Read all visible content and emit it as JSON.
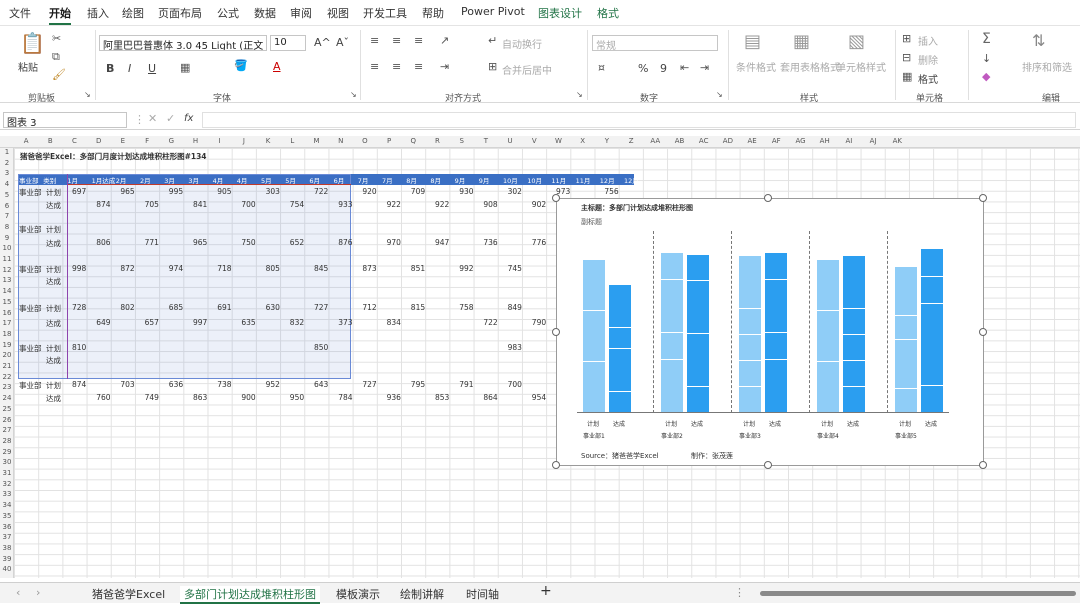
{
  "menu": {
    "file": "文件",
    "home": "开始",
    "insert": "插入",
    "draw": "绘图",
    "page_layout": "页面布局",
    "formulas": "公式",
    "data": "数据",
    "review": "审阅",
    "view": "视图",
    "developer": "开发工具",
    "help": "帮助",
    "power_pivot": "Power Pivot",
    "chart_design": "图表设计",
    "format": "格式"
  },
  "ribbon": {
    "clipboard": {
      "paste": "粘贴",
      "group": "剪贴板"
    },
    "font": {
      "family": "阿里巴巴普惠体 3.0 45 Light (正文",
      "size": "10",
      "bold": "B",
      "italic": "I",
      "underline": "U",
      "font_color_glyph": "A",
      "grow": "A^",
      "shrink": "Aˇ",
      "group": "字体"
    },
    "alignment": {
      "wrap": "自动换行",
      "merge": "合并后居中",
      "group": "对齐方式"
    },
    "number": {
      "format": "常规",
      "percent": "%",
      "comma": "9",
      "group": "数字"
    },
    "styles": {
      "conditional": "条件格式",
      "as_table": "套用表格格式",
      "cell_styles": "单元格样式",
      "group": "样式"
    },
    "cells": {
      "insert": "插入",
      "delete": "删除",
      "format": "格式",
      "group": "单元格"
    },
    "editing": {
      "sum": "Σ",
      "sort": "排序和筛选",
      "find": "查找和选择",
      "group": "编辑"
    },
    "launcher_glyph": "↘"
  },
  "formula_bar": {
    "name_box": "图表 3",
    "formula": "",
    "fx": "fx"
  },
  "columns": [
    "A",
    "B",
    "C",
    "D",
    "E",
    "F",
    "G",
    "H",
    "I",
    "J",
    "K",
    "L",
    "M",
    "N",
    "O",
    "P",
    "Q",
    "R",
    "S",
    "T",
    "U",
    "V",
    "W",
    "X",
    "Y",
    "Z",
    "AA",
    "AB",
    "AC",
    "AD",
    "AE",
    "AF",
    "AG",
    "AH",
    "AI",
    "AJ",
    "AK"
  ],
  "rows": [
    "1",
    "2",
    "3",
    "4",
    "5",
    "6",
    "7",
    "8",
    "9",
    "10",
    "11",
    "12",
    "13",
    "14",
    "15",
    "16",
    "17",
    "18",
    "19",
    "20",
    "21",
    "22",
    "23",
    "24",
    "25",
    "26",
    "27",
    "28",
    "29",
    "30",
    "31",
    "32",
    "33",
    "34",
    "35",
    "36",
    "37",
    "38",
    "39",
    "40"
  ],
  "sheet": {
    "title": "猪爸爸学Excel：多部门月度计划达成堆积柱形图#134",
    "header_row": [
      "事业部",
      "类别",
      "1月",
      "1月达成",
      "2月",
      "2月",
      "3月",
      "3月",
      "4月",
      "4月",
      "5月",
      "5月",
      "6月",
      "6月",
      "7月",
      "7月",
      "8月",
      "8月",
      "9月",
      "9月",
      "10月",
      "10月",
      "11月",
      "11月",
      "12月",
      "12月"
    ],
    "rows": [
      {
        "dept": "事业部",
        "type": "计划",
        "vals": [
          "697",
          "",
          "965",
          "",
          "995",
          "",
          "905",
          "",
          "303",
          "",
          "722",
          "",
          "920",
          "",
          "709",
          "",
          "930",
          "",
          "302",
          "",
          "973",
          "",
          "756",
          ""
        ]
      },
      {
        "dept": "",
        "type": "达成",
        "vals": [
          "",
          "874",
          "",
          "705",
          "",
          "841",
          "",
          "700",
          "",
          "754",
          "",
          "933",
          "",
          "922",
          "",
          "922",
          "",
          "908",
          "",
          "902",
          "",
          ""
        ]
      },
      {
        "dept": "事业部",
        "type": "计划",
        "vals": [
          "",
          "",
          "",
          "",
          "",
          "",
          "",
          "",
          "",
          "",
          "",
          "",
          "",
          "",
          "",
          "",
          "",
          "",
          "",
          "",
          "",
          ""
        ]
      },
      {
        "dept": "",
        "type": "达成",
        "vals": [
          "",
          "806",
          "",
          "771",
          "",
          "965",
          "",
          "750",
          "",
          "652",
          "",
          "876",
          "",
          "970",
          "",
          "947",
          "",
          "736",
          "",
          "776",
          "",
          ""
        ]
      },
      {
        "dept": "事业部",
        "type": "计划",
        "vals": [
          "998",
          "",
          "872",
          "",
          "974",
          "",
          "718",
          "",
          "805",
          "",
          "845",
          "",
          "873",
          "",
          "851",
          "",
          "992",
          "",
          "745",
          "",
          "",
          ""
        ]
      },
      {
        "dept": "",
        "type": "达成",
        "vals": [
          "",
          "",
          "",
          "",
          "",
          "",
          "",
          "",
          "",
          "",
          "",
          "",
          "",
          "",
          "",
          "",
          "",
          "",
          "",
          "",
          "",
          ""
        ]
      },
      {
        "dept": "事业部",
        "type": "计划",
        "vals": [
          "728",
          "",
          "802",
          "",
          "685",
          "",
          "691",
          "",
          "630",
          "",
          "727",
          "",
          "712",
          "",
          "815",
          "",
          "758",
          "",
          "849",
          "",
          "",
          ""
        ]
      },
      {
        "dept": "",
        "type": "达成",
        "vals": [
          "",
          "649",
          "",
          "657",
          "",
          "997",
          "",
          "635",
          "",
          "832",
          "",
          "373",
          "",
          "834",
          "",
          "",
          "",
          "722",
          "",
          "790",
          "",
          ""
        ]
      },
      {
        "dept": "事业部",
        "type": "计划",
        "vals": [
          "810",
          "",
          "",
          "",
          "",
          "",
          "",
          "",
          "",
          "",
          "850",
          "",
          "",
          "",
          "",
          "",
          "",
          "",
          "983",
          "",
          "",
          ""
        ]
      },
      {
        "dept": "",
        "type": "达成",
        "vals": [
          "",
          "",
          "",
          "",
          "",
          "",
          "",
          "",
          "",
          "",
          "",
          "",
          "",
          "",
          "",
          "",
          "",
          "",
          "",
          "",
          "",
          ""
        ]
      },
      {
        "dept": "事业部",
        "type": "计划",
        "vals": [
          "874",
          "",
          "703",
          "",
          "636",
          "",
          "738",
          "",
          "952",
          "",
          "643",
          "",
          "727",
          "",
          "795",
          "",
          "791",
          "",
          "700",
          "",
          "74",
          ""
        ]
      },
      {
        "dept": "",
        "type": "达成",
        "vals": [
          "",
          "760",
          "",
          "749",
          "",
          "863",
          "",
          "900",
          "",
          "950",
          "",
          "784",
          "",
          "936",
          "",
          "853",
          "",
          "864",
          "",
          "954",
          "",
          ""
        ]
      }
    ]
  },
  "chart": {
    "title": "主标题：多部门计划达成堆积柱形图",
    "subtitle": "副标题",
    "source": "Source：猪爸爸学Excel",
    "author": "制作：张茂莲",
    "x_labels": [
      "计划",
      "达成"
    ],
    "colors": {
      "plan": "#8fcdf7",
      "achieved": "#2b9ef0"
    },
    "categories": [
      "事业部1",
      "事业部2",
      "事业部3",
      "事业部4",
      "事业部5"
    ]
  },
  "chart_data": {
    "type": "bar",
    "stacked": true,
    "title": "主标题：多部门计划达成堆积柱形图",
    "subtitle": "副标题",
    "categories": [
      "事业部1",
      "事业部2",
      "事业部3",
      "事业部4",
      "事业部5"
    ],
    "series": [
      {
        "stack": "计划",
        "values": [
          [
            "",
            "",
            "",
            "",
            "",
            ""
          ],
          [
            "",
            "",
            "",
            "",
            "",
            ""
          ],
          [
            "",
            "",
            "",
            "",
            "",
            ""
          ],
          [
            "",
            "",
            "",
            "",
            "",
            ""
          ],
          [
            "",
            "",
            "",
            "",
            "",
            ""
          ]
        ]
      },
      {
        "stack": "达成",
        "values": [
          [
            "",
            "",
            "",
            "",
            "",
            ""
          ],
          [
            "",
            "",
            "",
            "",
            "",
            ""
          ],
          [
            "",
            "",
            "",
            "",
            "",
            ""
          ],
          [
            "",
            "",
            "",
            "",
            "",
            ""
          ],
          [
            "",
            "",
            "",
            "",
            "",
            ""
          ]
        ]
      }
    ],
    "segments_per_bar": [
      [
        6,
        6
      ],
      [
        6,
        6
      ],
      [
        6,
        6
      ],
      [
        6,
        6
      ],
      [
        6,
        6
      ]
    ],
    "relative_heights": [
      [
        0.86,
        0.72
      ],
      [
        0.9,
        0.89
      ],
      [
        0.88,
        0.9
      ],
      [
        0.86,
        0.88
      ],
      [
        0.82,
        0.92
      ]
    ],
    "segment_labels": [
      [
        [
          "",
          "",
          "",
          "",
          "",
          ""
        ],
        [
          "",
          "",
          "",
          "",
          "",
          ""
        ]
      ],
      [
        [
          "",
          "",
          "",
          "",
          "",
          ""
        ],
        [
          "",
          "",
          "",
          "",
          "",
          ""
        ]
      ],
      [
        [
          "",
          "",
          "",
          "",
          "",
          ""
        ],
        [
          "",
          "",
          "",
          "",
          "",
          ""
        ]
      ],
      [
        [
          "",
          "",
          "",
          "",
          "",
          ""
        ],
        [
          "",
          "",
          "",
          "",
          "",
          ""
        ]
      ],
      [
        [
          "",
          "",
          "",
          "",
          "",
          ""
        ],
        [
          "",
          "",
          "",
          "",
          "",
          ""
        ]
      ]
    ],
    "legend": "none",
    "grid": false
  },
  "sheet_tabs": [
    "猪爸爸学Excel",
    "多部门计划达成堆积柱形图",
    "模板演示",
    "绘制讲解",
    "时间轴"
  ],
  "sheet_nav": {
    "prev": "‹",
    "next": "›",
    "add": "+",
    "more": "⋮"
  }
}
